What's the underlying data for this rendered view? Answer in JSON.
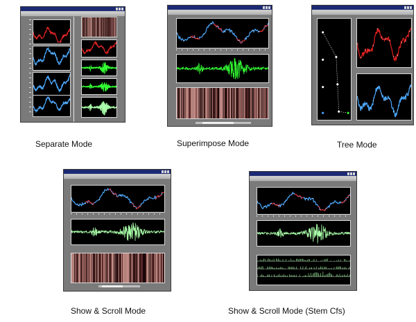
{
  "captions": {
    "separate": "Separate Mode",
    "superimpose": "Superimpose Mode",
    "tree": "Tree Mode",
    "show_scroll": "Show & Scroll Mode",
    "show_scroll_stem": "Show & Scroll Mode (Stem Cfs)"
  },
  "colors": {
    "window_bg": "#7a7a7a",
    "titlebar": "#1c2a74",
    "pane_bg": "#000000",
    "signal_red": "#e02020",
    "signal_blue": "#4aa8ff",
    "signal_green": "#33ff33",
    "signal_light_green": "#aaffaa",
    "coef_stripes": "#c08a84"
  },
  "icons": {
    "titlebar_controls": "window-controls-icon"
  }
}
